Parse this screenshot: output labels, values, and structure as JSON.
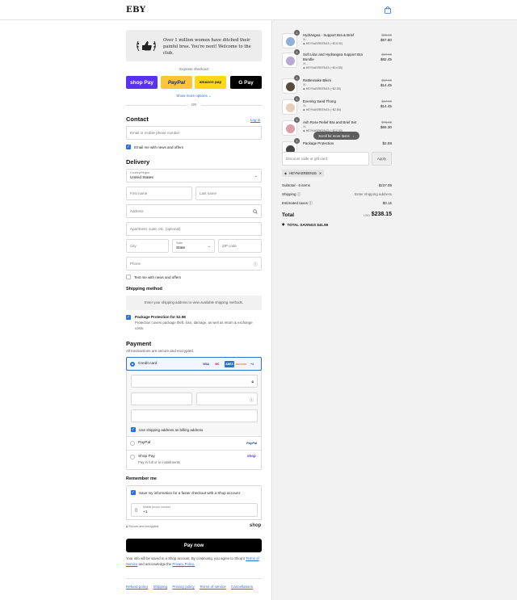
{
  "header": {
    "logo": "EBY"
  },
  "banner": {
    "text": "Over 1 million women have ditched their painful bras. You're next! Welcome to the club."
  },
  "express": {
    "label": "Express checkout",
    "shoppay": "shop Pay",
    "paypal": "PayPal",
    "amazon": "amazon pay",
    "gpay": "G Pay",
    "more": "Show more options",
    "or": "OR"
  },
  "contact": {
    "title": "Contact",
    "login": "Log in",
    "email_placeholder": "Email or mobile phone number",
    "news_label": "Email me with news and offers"
  },
  "delivery": {
    "title": "Delivery",
    "country_label": "Country/Region",
    "country_value": "United States",
    "first_name": "First name",
    "last_name": "Last name",
    "address": "Address",
    "apartment": "Apartment, suite, etc. (optional)",
    "city": "City",
    "state_label": "State",
    "state_value": "State",
    "zip": "ZIP code",
    "phone": "Phone",
    "text_label": "Text me with news and offers"
  },
  "shipping": {
    "title": "Shipping method",
    "message": "Enter your shipping address to view available shipping methods.",
    "protection_title": "Package Protection for $2.98",
    "protection_desc": "Protection covers package theft, loss, damage, as well as return & exchange costs."
  },
  "payment": {
    "title": "Payment",
    "subtitle": "All transactions are secure and encrypted.",
    "credit_card": "Credit card",
    "card_logos": [
      "VISA",
      "MC",
      "AMEX",
      "DISCOVER",
      "+4"
    ],
    "billing_label": "Use shipping address as billing address",
    "paypal_label": "PayPal",
    "paypal_logo": "PayPal",
    "shoppay_label": "Shop Pay",
    "shoppay_sub": "Pay in full or in installments",
    "shoppay_logo": "shop"
  },
  "remember": {
    "title": "Remember me",
    "save_label": "Save my information for a faster checkout with a Shop account",
    "phone_label": "Mobile phone number",
    "phone_value": "+1",
    "secure": "Secure and encrypted",
    "shop_mark": "shop"
  },
  "pay_now": "Pay now",
  "legal": {
    "text": "Your info will be saved to a Shop account. By continuing, you agree to Shop's",
    "terms": "Terms of Service",
    "and": "and acknowledge the",
    "privacy": "Privacy Policy."
  },
  "footer": [
    "Refund policy",
    "Shipping",
    "Privacy policy",
    "Terms of service",
    "Cancellations"
  ],
  "cart": {
    "items": [
      {
        "name": "Hydrangea - Support Bra & Brief",
        "variant": "XL",
        "code": "HEYNASREEN15 (−$15.30)",
        "old": "$85.00",
        "new": "$57.80",
        "qty": "1",
        "color": "#8fb0d8"
      },
      {
        "name": "Soft Lilac and Hydrangea Support Bra Bundle",
        "variant": "XL",
        "code": "HEYNASREEN15 (−$14.55)",
        "old": "$97.00",
        "new": "$82.45",
        "qty": "1",
        "color": "#b8a8d8"
      },
      {
        "name": "Rattlesnake Bikini",
        "variant": "XL",
        "code": "HEYNASREEN15 (−$2.55)",
        "old": "$17.00",
        "new": "$14.45",
        "qty": "1",
        "color": "#5a4a3a"
      },
      {
        "name": "Evening Sand Thong",
        "variant": "XL",
        "code": "HEYNASREEN15 (−$2.55)",
        "old": "$17.00",
        "new": "$14.45",
        "qty": "1",
        "color": "#e8cdb8"
      },
      {
        "name": "Ash Rose Relief Bra and Brief Set",
        "variant": "XL",
        "code": "HEYNASREEN15 (−$12.00)",
        "old": "$78.00",
        "new": "$66.30",
        "qty": "1",
        "color": "#d8a0a8"
      },
      {
        "name": "Package Protection",
        "variant": "",
        "code": "",
        "old": "",
        "new": "$2.98",
        "qty": "1",
        "color": "#444444"
      }
    ],
    "scroll_hint": "Scroll for more items",
    "discount_placeholder": "Discount code or gift card",
    "apply": "Apply",
    "applied_code": "HEYNASREEN15",
    "subtotal_label": "Subtotal · 6 items",
    "subtotal_value": "$237.99",
    "shipping_label": "Shipping",
    "shipping_value": "Enter shipping address",
    "taxes_label": "Estimated taxes",
    "taxes_value": "$0.16",
    "total_label": "Total",
    "currency": "USD",
    "total_value": "$238.15",
    "savings": "TOTAL SAVINGS  $41.99"
  }
}
